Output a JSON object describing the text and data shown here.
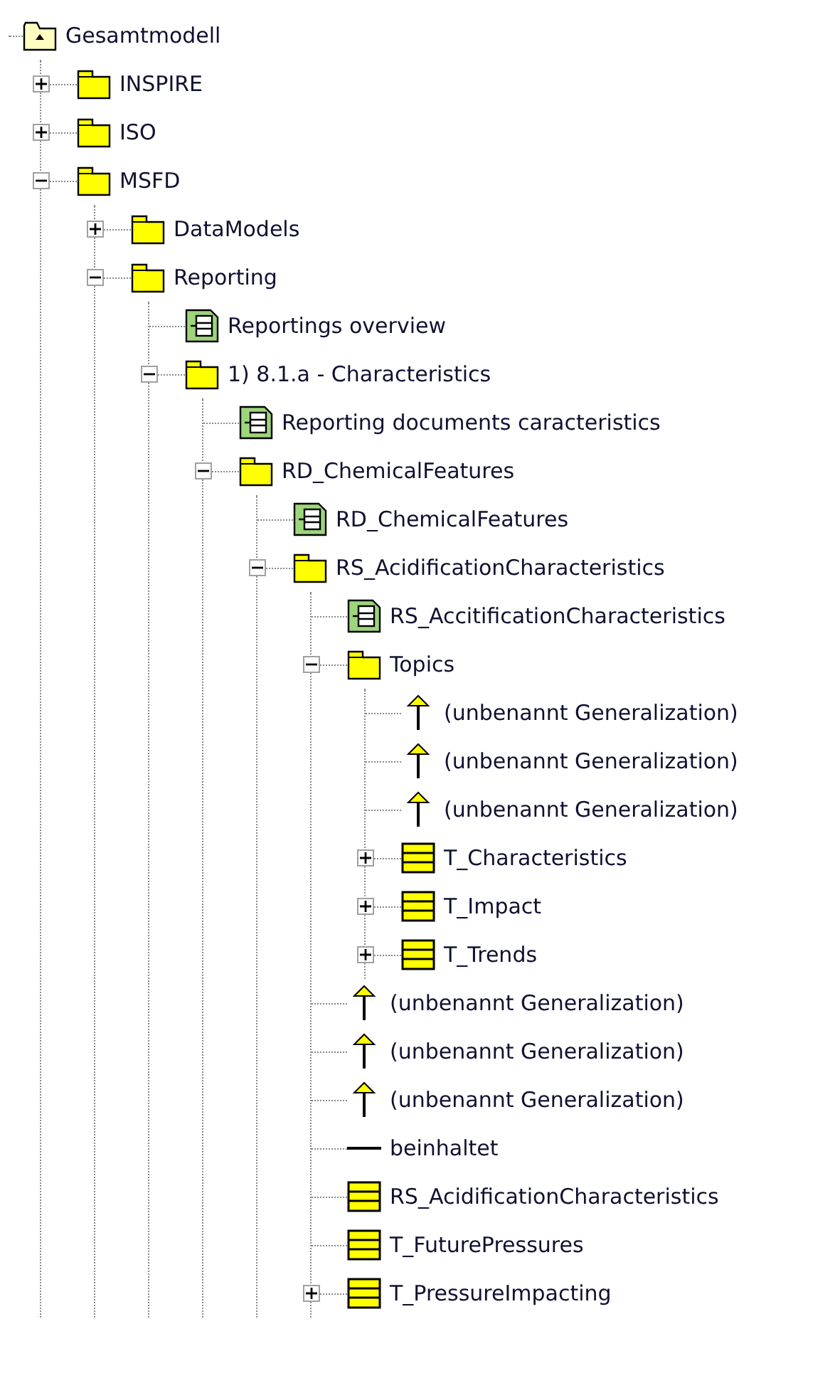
{
  "tree": [
    {
      "kind": "model",
      "label": "Gesamtmodell",
      "children": [
        {
          "kind": "package",
          "label": "INSPIRE",
          "expanded": false
        },
        {
          "kind": "package",
          "label": "ISO",
          "expanded": false
        },
        {
          "kind": "package",
          "label": "MSFD",
          "expanded": true,
          "children": [
            {
              "kind": "package",
              "label": "DataModels",
              "expanded": false
            },
            {
              "kind": "package",
              "label": "Reporting",
              "expanded": true,
              "children": [
                {
                  "kind": "diagram",
                  "label": "Reportings overview"
                },
                {
                  "kind": "package",
                  "label": "1) 8.1.a - Characteristics",
                  "expanded": true,
                  "children": [
                    {
                      "kind": "diagram",
                      "label": "Reporting documents caracteristics"
                    },
                    {
                      "kind": "package",
                      "label": "RD_ChemicalFeatures",
                      "expanded": true,
                      "children": [
                        {
                          "kind": "diagram",
                          "label": "RD_ChemicalFeatures"
                        },
                        {
                          "kind": "package",
                          "label": "RS_AcidificationCharacteristics",
                          "expanded": true,
                          "children": [
                            {
                              "kind": "diagram",
                              "label": "RS_AccitificationCharacteristics"
                            },
                            {
                              "kind": "package",
                              "label": "Topics",
                              "expanded": true,
                              "children": [
                                {
                                  "kind": "generalization",
                                  "label": "(unbenannt Generalization)"
                                },
                                {
                                  "kind": "generalization",
                                  "label": "(unbenannt Generalization)"
                                },
                                {
                                  "kind": "generalization",
                                  "label": "(unbenannt Generalization)"
                                },
                                {
                                  "kind": "class",
                                  "label": "T_Characteristics",
                                  "expanded": false
                                },
                                {
                                  "kind": "class",
                                  "label": "T_Impact",
                                  "expanded": false
                                },
                                {
                                  "kind": "class",
                                  "label": "T_Trends",
                                  "expanded": false
                                }
                              ]
                            },
                            {
                              "kind": "generalization",
                              "label": "(unbenannt Generalization)"
                            },
                            {
                              "kind": "generalization",
                              "label": "(unbenannt Generalization)"
                            },
                            {
                              "kind": "generalization",
                              "label": "(unbenannt Generalization)"
                            },
                            {
                              "kind": "association",
                              "label": "beinhaltet"
                            },
                            {
                              "kind": "class",
                              "label": "RS_AcidificationCharacteristics"
                            },
                            {
                              "kind": "class",
                              "label": "T_FuturePressures"
                            },
                            {
                              "kind": "class",
                              "label": "T_PressureImpacting",
                              "expanded": false
                            }
                          ]
                        }
                      ]
                    }
                  ]
                }
              ]
            }
          ]
        }
      ]
    }
  ]
}
